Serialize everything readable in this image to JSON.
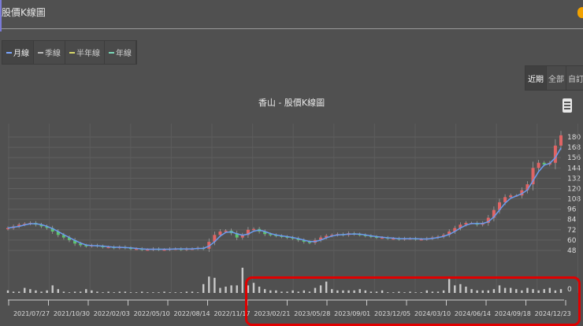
{
  "header": {
    "title": "股價K線圖"
  },
  "legend": [
    {
      "label": "月線",
      "color": "#7aa6ff"
    },
    {
      "label": "季線",
      "color": "#bbbbbb"
    },
    {
      "label": "半年線",
      "color": "#d8d86a"
    },
    {
      "label": "年線",
      "color": "#7ad8b8"
    }
  ],
  "range_buttons": [
    {
      "label": "近期"
    },
    {
      "label": "全部"
    },
    {
      "label": "自訂"
    }
  ],
  "colors": {
    "up": "#e06464",
    "down": "#5ec46e",
    "ma": "#6b9cf0",
    "highlight": "#e00000"
  },
  "chart_data": {
    "type": "candlestick",
    "title": "香山 - 股價K線圖",
    "ylim": [
      44,
      192
    ],
    "yticks": [
      48,
      60,
      72,
      84,
      96,
      108,
      120,
      132,
      144,
      156,
      168,
      180
    ],
    "volume_tick": "0",
    "xticks": [
      "2021/07/27",
      "2021/10/30",
      "2022/02/03",
      "2022/05/10",
      "2022/08/14",
      "2022/11/17",
      "2023/02/21",
      "2023/05/28",
      "2023/09/01",
      "2023/12/05",
      "2024/03/10",
      "2024/06/14",
      "2024/09/18",
      "2024/12/23"
    ],
    "close": [
      74,
      76,
      78,
      79,
      80,
      78,
      76,
      74,
      70,
      66,
      63,
      60,
      56,
      54,
      53,
      54,
      53,
      52,
      52,
      51,
      52,
      51,
      50,
      50,
      49,
      49,
      50,
      49,
      49,
      50,
      50,
      49,
      50,
      50,
      51,
      50,
      58,
      66,
      70,
      71,
      68,
      63,
      66,
      72,
      73,
      70,
      67,
      66,
      65,
      64,
      63,
      62,
      60,
      58,
      57,
      60,
      63,
      65,
      66,
      67,
      66,
      68,
      67,
      66,
      65,
      64,
      63,
      63,
      62,
      62,
      61,
      62,
      62,
      61,
      61,
      62,
      63,
      64,
      66,
      70,
      74,
      78,
      80,
      80,
      78,
      80,
      86,
      95,
      104,
      110,
      112,
      112,
      118,
      125,
      144,
      150,
      148,
      150,
      170,
      182
    ],
    "volume": [
      2,
      1,
      1,
      4,
      3,
      2,
      1,
      2,
      6,
      3,
      1,
      0,
      1,
      1,
      3,
      2,
      1,
      0,
      1,
      0,
      1,
      1,
      0,
      0,
      1,
      0,
      0,
      0,
      1,
      0,
      0,
      0,
      1,
      1,
      0,
      7,
      13,
      12,
      4,
      5,
      6,
      6,
      20,
      6,
      8,
      5,
      3,
      2,
      2,
      1,
      1,
      2,
      1,
      2,
      1,
      4,
      6,
      9,
      3,
      2,
      2,
      2,
      2,
      3,
      2,
      1,
      1,
      2,
      0,
      0,
      1,
      0,
      1,
      0,
      0,
      2,
      1,
      1,
      2,
      11,
      6,
      7,
      5,
      3,
      2,
      2,
      2,
      3,
      6,
      4,
      4,
      3,
      2,
      4,
      3,
      2,
      3,
      4,
      2,
      3
    ]
  }
}
